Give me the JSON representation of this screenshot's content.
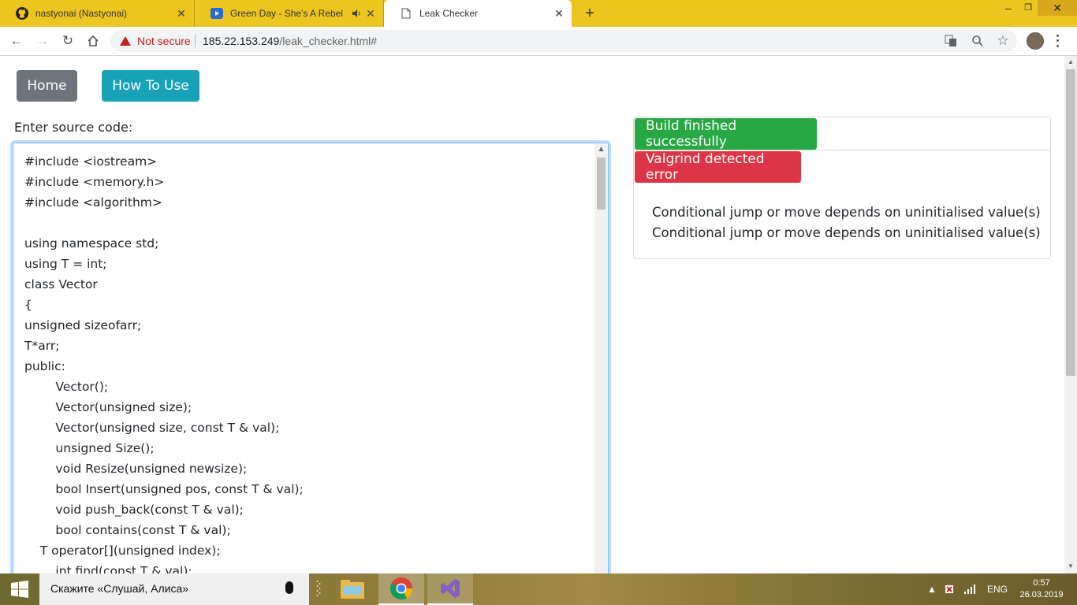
{
  "browser": {
    "tabs": [
      {
        "title": "nastyonai (Nastyonai)",
        "icon": "github-icon",
        "active": false
      },
      {
        "title": "Green Day - She's A Rebel",
        "icon": "youtube-icon",
        "active": false,
        "audio": true
      },
      {
        "title": "Leak Checker",
        "icon": "page-icon",
        "active": true
      }
    ],
    "security_label": "Not secure",
    "url_host": "185.22.153.249",
    "url_path": "/leak_checker.html#"
  },
  "page": {
    "nav": {
      "home_label": "Home",
      "howto_label": "How To Use"
    },
    "editor_label": "Enter source code:",
    "source_code": "#include <iostream>\n#include <memory.h>\n#include <algorithm>\n\nusing namespace std;\nusing T = int;\nclass Vector\n{\nunsigned sizeofarr;\nT*arr;\npublic:\n        Vector();\n        Vector(unsigned size);\n        Vector(unsigned size, const T & val);\n        unsigned Size();\n        void Resize(unsigned newsize);\n        bool Insert(unsigned pos, const T & val);\n        void push_back(const T & val);\n        bool contains(const T & val);\n    T operator[](unsigned index);\n        int find(const T & val);",
    "build_status": "Build finished successfully",
    "valgrind_status": "Valgrind detected error",
    "messages": [
      "Conditional jump or move depends on uninitialised value(s)",
      "Conditional jump or move depends on uninitialised value(s)"
    ],
    "colors": {
      "build_ok": "#28a745",
      "valgrind_error": "#dc3545",
      "home_button": "#6c757d",
      "howto_button": "#17a2b8"
    }
  },
  "taskbar": {
    "search_placeholder": "Скажите «Слушай, Алиса»",
    "language": "ENG",
    "time": "0:57",
    "date": "26.03.2019"
  }
}
